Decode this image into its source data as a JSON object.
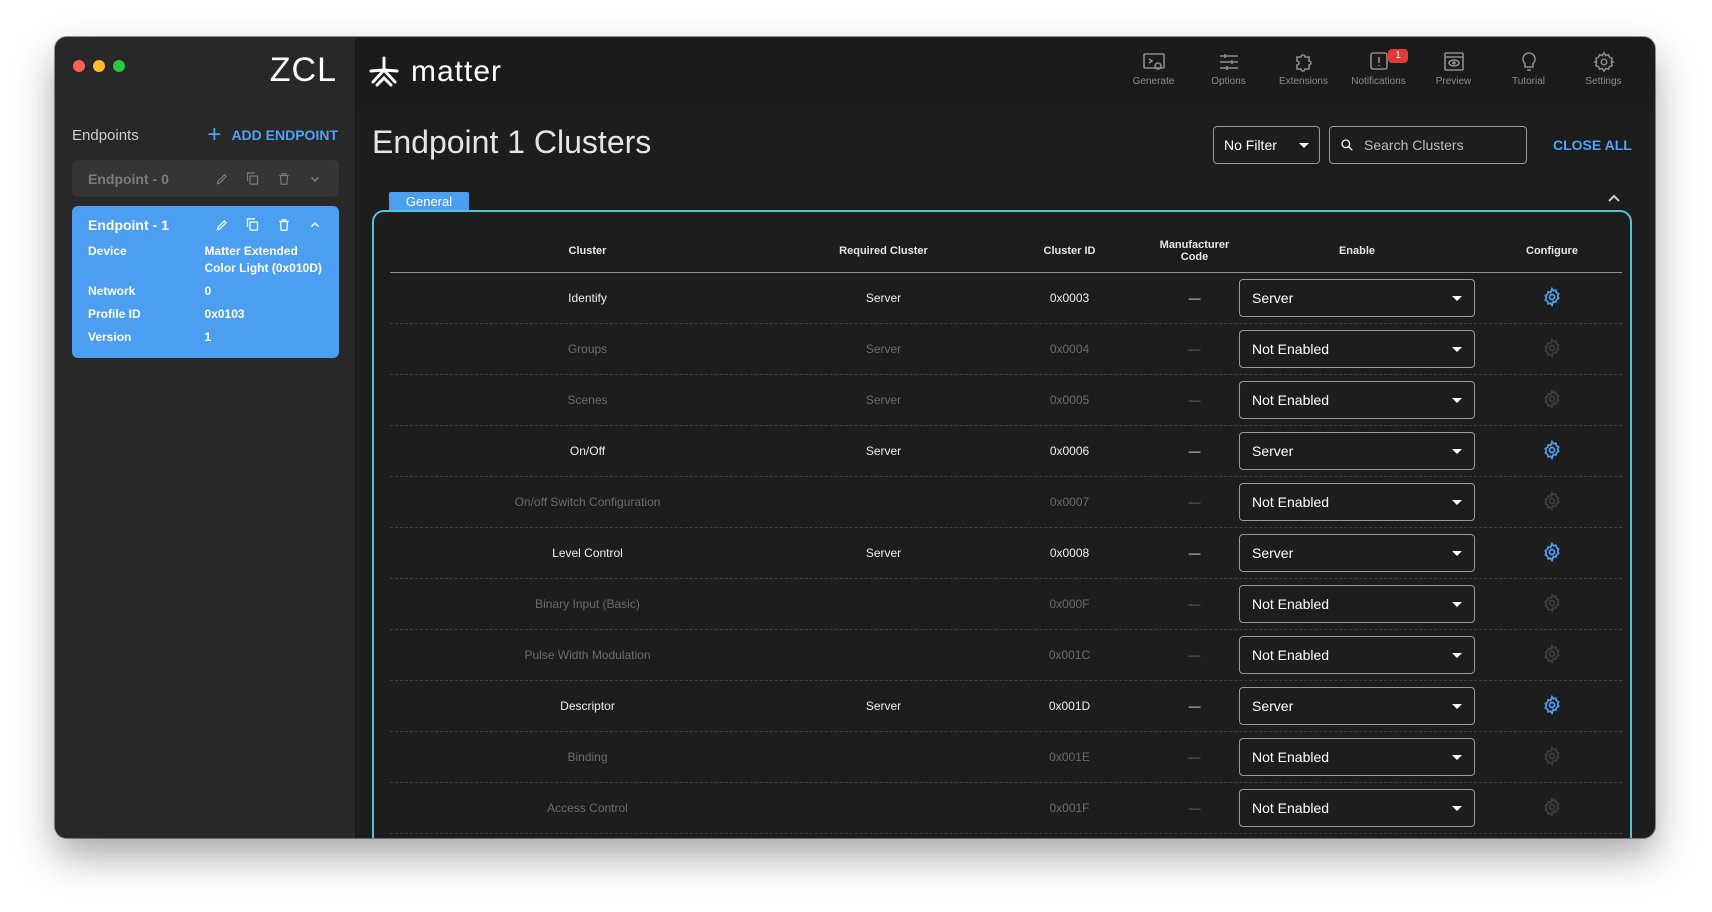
{
  "sidebar": {
    "logo": "ZCL",
    "endpoints_label": "Endpoints",
    "add_endpoint": "ADD ENDPOINT",
    "endpoint0": {
      "title": "Endpoint - 0"
    },
    "endpoint1": {
      "title": "Endpoint - 1",
      "device_label": "Device",
      "device_value": "Matter Extended Color Light (0x010D)",
      "network_label": "Network",
      "network_value": "0",
      "profile_label": "Profile ID",
      "profile_value": "0x0103",
      "version_label": "Version",
      "version_value": "1"
    }
  },
  "topbar": {
    "brand": "matter",
    "nav": [
      {
        "label": "Generate",
        "icon": "generate-icon"
      },
      {
        "label": "Options",
        "icon": "options-icon"
      },
      {
        "label": "Extensions",
        "icon": "extensions-icon"
      },
      {
        "label": "Notifications",
        "icon": "notifications-icon",
        "badge": "1"
      },
      {
        "label": "Preview",
        "icon": "preview-icon"
      },
      {
        "label": "Tutorial",
        "icon": "tutorial-icon"
      },
      {
        "label": "Settings",
        "icon": "settings-icon"
      }
    ]
  },
  "main": {
    "title": "Endpoint 1 Clusters",
    "filter": "No Filter",
    "search_placeholder": "Search Clusters",
    "close_all": "CLOSE ALL",
    "domain_tab": "General",
    "table": {
      "headers": [
        "Cluster",
        "Required Cluster",
        "Cluster ID",
        "Manufacturer Code",
        "Enable",
        "Configure"
      ],
      "rows": [
        {
          "cluster": "Identify",
          "required": "Server",
          "id": "0x0003",
          "mfg": "—",
          "enable": "Server",
          "enabled": true
        },
        {
          "cluster": "Groups",
          "required": "Server",
          "id": "0x0004",
          "mfg": "—",
          "enable": "Not Enabled",
          "enabled": false
        },
        {
          "cluster": "Scenes",
          "required": "Server",
          "id": "0x0005",
          "mfg": "—",
          "enable": "Not Enabled",
          "enabled": false
        },
        {
          "cluster": "On/Off",
          "required": "Server",
          "id": "0x0006",
          "mfg": "—",
          "enable": "Server",
          "enabled": true
        },
        {
          "cluster": "On/off Switch Configuration",
          "required": "",
          "id": "0x0007",
          "mfg": "—",
          "enable": "Not Enabled",
          "enabled": false
        },
        {
          "cluster": "Level Control",
          "required": "Server",
          "id": "0x0008",
          "mfg": "—",
          "enable": "Server",
          "enabled": true
        },
        {
          "cluster": "Binary Input (Basic)",
          "required": "",
          "id": "0x000F",
          "mfg": "—",
          "enable": "Not Enabled",
          "enabled": false
        },
        {
          "cluster": "Pulse Width Modulation",
          "required": "",
          "id": "0x001C",
          "mfg": "—",
          "enable": "Not Enabled",
          "enabled": false
        },
        {
          "cluster": "Descriptor",
          "required": "Server",
          "id": "0x001D",
          "mfg": "—",
          "enable": "Server",
          "enabled": true
        },
        {
          "cluster": "Binding",
          "required": "",
          "id": "0x001E",
          "mfg": "—",
          "enable": "Not Enabled",
          "enabled": false
        },
        {
          "cluster": "Access Control",
          "required": "",
          "id": "0x001F",
          "mfg": "—",
          "enable": "Not Enabled",
          "enabled": false
        }
      ]
    }
  },
  "colors": {
    "accent": "#4ea3f7",
    "endpoint_selected": "#4c9ff0",
    "panel_border": "#52c6ce",
    "badge": "#e53935"
  }
}
